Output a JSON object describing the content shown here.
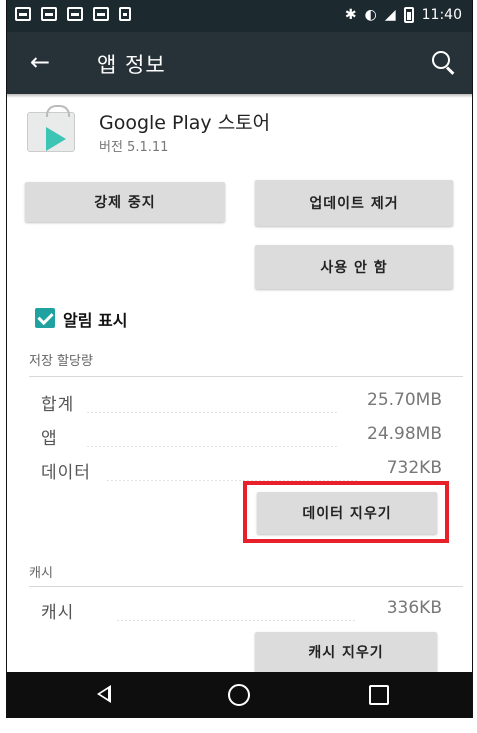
{
  "status_bar": {
    "time": "11:40",
    "icons": [
      "notification-icon",
      "notification-icon",
      "notification-icon",
      "notification-icon",
      "notification-icon",
      "bluetooth-icon",
      "vibrate-icon",
      "signal-icon",
      "battery-icon"
    ]
  },
  "app_bar": {
    "title": "앱 정보",
    "back_icon": "arrow-left-icon",
    "search_icon": "search-icon"
  },
  "app": {
    "name": "Google Play 스토어",
    "version": "버전 5.1.11"
  },
  "buttons": {
    "force_stop": "강제 중지",
    "uninstall_updates": "업데이트 제거",
    "disable": "사용 안 함",
    "clear_data": "데이터 지우기",
    "clear_cache": "캐시 지우기"
  },
  "notifications": {
    "label": "알림 표시",
    "checked": true
  },
  "storage": {
    "section_label": "저장 할당량",
    "rows": [
      {
        "label": "합계",
        "value": "25.70MB"
      },
      {
        "label": "앱",
        "value": "24.98MB"
      },
      {
        "label": "데이터",
        "value": "732KB"
      }
    ]
  },
  "cache": {
    "section_label": "캐시",
    "row": {
      "label": "캐시",
      "value": "336KB"
    }
  },
  "colors": {
    "app_bar": "#263238",
    "status_bar": "#1c2a30",
    "checkbox": "#1fa2a0",
    "highlight": "#e8202a"
  }
}
